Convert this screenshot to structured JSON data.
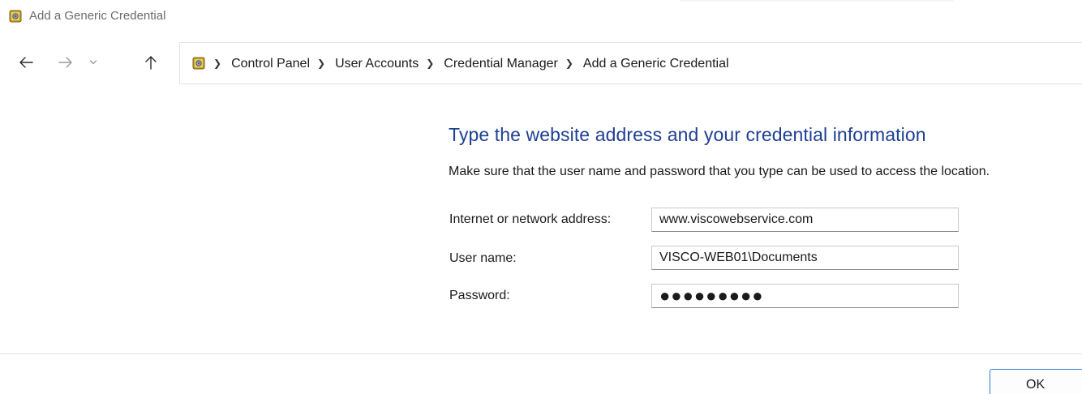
{
  "window": {
    "title": "Add a Generic Credential"
  },
  "navigation": {
    "back_icon": "arrow-left-icon",
    "forward_icon": "arrow-right-icon",
    "recent_icon": "chevron-down-icon",
    "up_icon": "arrow-up-icon",
    "breadcrumbs": [
      "Control Panel",
      "User Accounts",
      "Credential Manager",
      "Add a Generic Credential"
    ]
  },
  "form": {
    "heading": "Type the website address and your credential information",
    "description": "Make sure that the user name and password that you type can be used to access the location.",
    "fields": [
      {
        "label": "Internet or network address:",
        "value": "www.viscowebservice.com"
      },
      {
        "label": "User name:",
        "value": "VISCO-WEB01\\Documents"
      },
      {
        "label": "Password:",
        "value": "●●●●●●●●●"
      }
    ]
  },
  "footer": {
    "ok_label": "OK"
  },
  "colors": {
    "heading": "#1e3f92",
    "ok_border": "#2f7fd4",
    "title_text": "#6b6b6b"
  }
}
